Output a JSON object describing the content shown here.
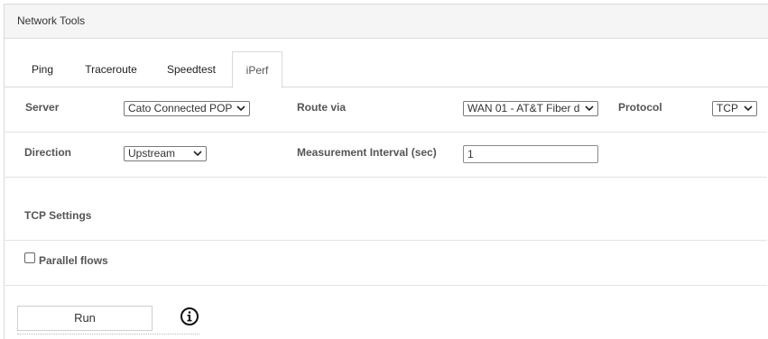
{
  "panel": {
    "title": "Network Tools"
  },
  "tabs": [
    {
      "label": "Ping"
    },
    {
      "label": "Traceroute"
    },
    {
      "label": "Speedtest"
    },
    {
      "label": "iPerf",
      "active": true
    }
  ],
  "form": {
    "server": {
      "label": "Server",
      "value": "Cato Connected POP"
    },
    "route": {
      "label": "Route via",
      "value": "WAN 01 - AT&T Fiber d"
    },
    "protocol": {
      "label": "Protocol",
      "value": "TCP"
    },
    "direction": {
      "label": "Direction",
      "value": "Upstream"
    },
    "interval": {
      "label": "Measurement Interval (sec)",
      "value": "1"
    }
  },
  "tcp_settings": {
    "heading": "TCP Settings",
    "parallel_flows_label": "Parallel flows",
    "parallel_flows_checked": false
  },
  "actions": {
    "run_label": "Run"
  },
  "icons": {
    "select_chevron": "chevron-down-icon",
    "info": "info-icon"
  }
}
